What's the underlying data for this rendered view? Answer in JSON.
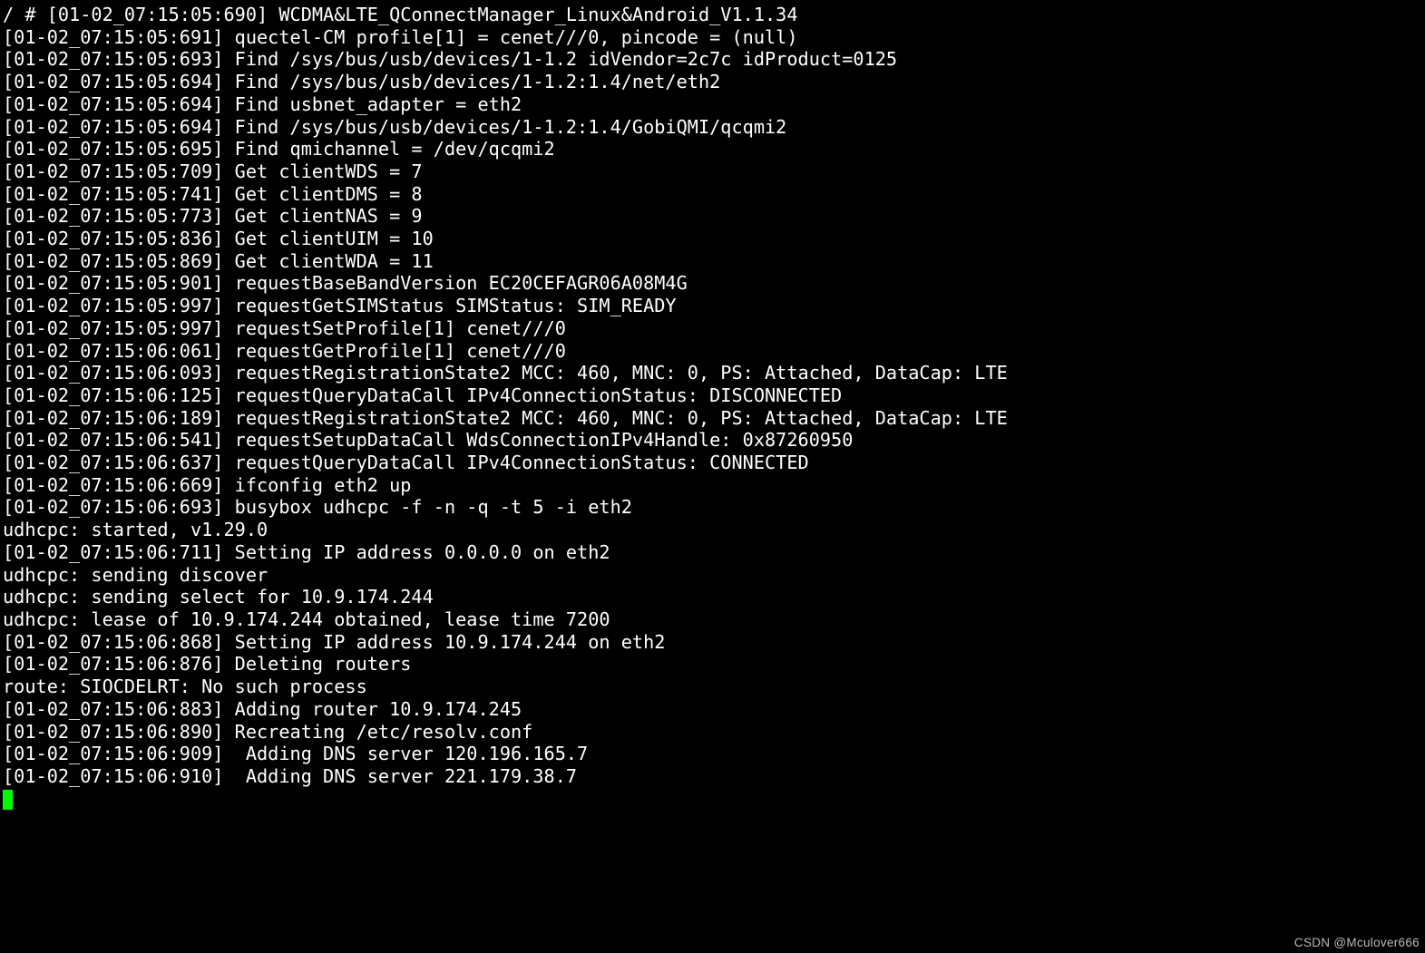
{
  "terminal": {
    "lines": [
      "/ # [01-02_07:15:05:690] WCDMA&LTE_QConnectManager_Linux&Android_V1.1.34",
      "[01-02_07:15:05:691] quectel-CM profile[1] = cenet///0, pincode = (null)",
      "[01-02_07:15:05:693] Find /sys/bus/usb/devices/1-1.2 idVendor=2c7c idProduct=0125",
      "[01-02_07:15:05:694] Find /sys/bus/usb/devices/1-1.2:1.4/net/eth2",
      "[01-02_07:15:05:694] Find usbnet_adapter = eth2",
      "[01-02_07:15:05:694] Find /sys/bus/usb/devices/1-1.2:1.4/GobiQMI/qcqmi2",
      "[01-02_07:15:05:695] Find qmichannel = /dev/qcqmi2",
      "[01-02_07:15:05:709] Get clientWDS = 7",
      "[01-02_07:15:05:741] Get clientDMS = 8",
      "[01-02_07:15:05:773] Get clientNAS = 9",
      "[01-02_07:15:05:836] Get clientUIM = 10",
      "[01-02_07:15:05:869] Get clientWDA = 11",
      "[01-02_07:15:05:901] requestBaseBandVersion EC20CEFAGR06A08M4G",
      "[01-02_07:15:05:997] requestGetSIMStatus SIMStatus: SIM_READY",
      "[01-02_07:15:05:997] requestSetProfile[1] cenet///0",
      "[01-02_07:15:06:061] requestGetProfile[1] cenet///0",
      "[01-02_07:15:06:093] requestRegistrationState2 MCC: 460, MNC: 0, PS: Attached, DataCap: LTE",
      "[01-02_07:15:06:125] requestQueryDataCall IPv4ConnectionStatus: DISCONNECTED",
      "[01-02_07:15:06:189] requestRegistrationState2 MCC: 460, MNC: 0, PS: Attached, DataCap: LTE",
      "[01-02_07:15:06:541] requestSetupDataCall WdsConnectionIPv4Handle: 0x87260950",
      "[01-02_07:15:06:637] requestQueryDataCall IPv4ConnectionStatus: CONNECTED",
      "[01-02_07:15:06:669] ifconfig eth2 up",
      "[01-02_07:15:06:693] busybox udhcpc -f -n -q -t 5 -i eth2",
      "udhcpc: started, v1.29.0",
      "[01-02_07:15:06:711] Setting IP address 0.0.0.0 on eth2",
      "udhcpc: sending discover",
      "udhcpc: sending select for 10.9.174.244",
      "udhcpc: lease of 10.9.174.244 obtained, lease time 7200",
      "[01-02_07:15:06:868] Setting IP address 10.9.174.244 on eth2",
      "[01-02_07:15:06:876] Deleting routers",
      "route: SIOCDELRT: No such process",
      "[01-02_07:15:06:883] Adding router 10.9.174.245",
      "[01-02_07:15:06:890] Recreating /etc/resolv.conf",
      "[01-02_07:15:06:909]  Adding DNS server 120.196.165.7",
      "[01-02_07:15:06:910]  Adding DNS server 221.179.38.7"
    ]
  },
  "watermark": "CSDN @Mculover666"
}
